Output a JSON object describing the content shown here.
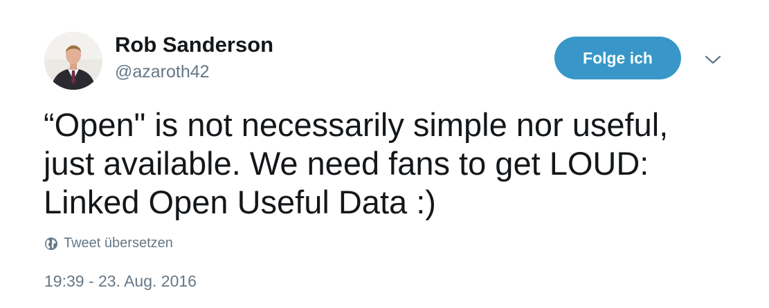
{
  "user": {
    "name": "Rob Sanderson",
    "handle": "@azaroth42"
  },
  "follow_button": {
    "label": "Folge ich",
    "color": "#3897c8"
  },
  "menu": {
    "icon": "chevron-down-icon"
  },
  "tweet": {
    "lines": [
      "“Open\" is not necessarily simple nor useful,",
      "just available. We need fans to get LOUD:",
      "Linked Open Useful Data :)"
    ]
  },
  "translate": {
    "icon": "globe-icon",
    "label": "Tweet übersetzen"
  },
  "timestamp": "19:39 - 23. Aug. 2016",
  "colors": {
    "text": "#14171a",
    "secondary": "#657786"
  }
}
